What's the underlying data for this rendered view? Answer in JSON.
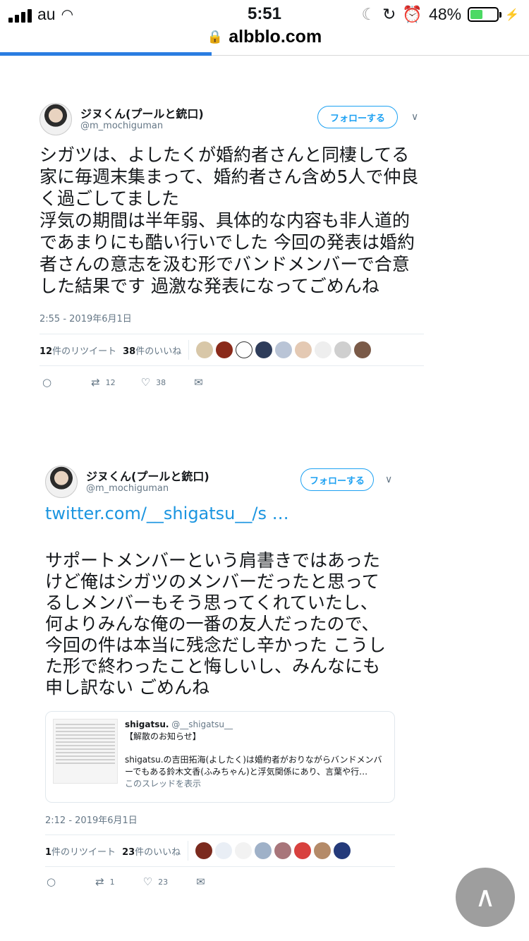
{
  "status": {
    "carrier": "au",
    "time": "5:51",
    "battery": "48%",
    "battery_level": 0.48
  },
  "browser": {
    "url": "albblo.com",
    "load_progress": 0.4
  },
  "tweets": [
    {
      "name": "ジヌくん(プールと銃口)",
      "handle": "@m_mochiguman",
      "follow_label": "フォローする",
      "text": "シガツは、よしたくが婚約者さんと同棲してる家に毎週末集まって、婚約者さん含め5人で仲良く過ごしてました\n浮気の期間は半年弱、具体的な内容も非人道的であまりにも酷い行いでした 今回の発表は婚約者さんの意志を汲む形でバンドメンバーで合意した結果です 過激な発表になってごめんね",
      "timestamp": "2:55 - 2019年6月1日",
      "retweets_num": "12",
      "retweets_suffix": "件のリツイート",
      "likes_num": "38",
      "likes_suffix": "件のいいね",
      "action_retweets": "12",
      "action_likes": "38"
    },
    {
      "name": "ジヌくん(プールと銃口)",
      "handle": "@m_mochiguman",
      "follow_label": "フォローする",
      "link": "twitter.com/__shigatsu__/s …",
      "text": "サポートメンバーという肩書きではあったけど俺はシガツのメンバーだったと思ってるしメンバーもそう思ってくれていたし、何よりみんな俺の一番の友人だったので、今回の件は本当に残念だし辛かった こうした形で終わったこと悔しいし、みんなにも申し訳ない ごめんね",
      "quote": {
        "name": "shigatsu.",
        "handle": "@__shigatsu__",
        "line1": "【解散のお知らせ】",
        "line2": "shigatsu.の吉田拓海(よしたく)は婚約者がおりながらバンドメンバーでもある鈴木文香(ふみちゃん)と浮気関係にあり、言葉や行…",
        "show_thread": "このスレッドを表示"
      },
      "timestamp": "2:12 - 2019年6月1日",
      "retweets_num": "1",
      "retweets_suffix": "件のリツイート",
      "likes_num": "23",
      "likes_suffix": "件のいいね",
      "action_retweets": "1",
      "action_likes": "23"
    }
  ],
  "icons": [
    "lock-icon",
    "reply-icon",
    "retweet-icon",
    "like-icon",
    "message-icon",
    "chevron-down-icon",
    "chevron-up-icon"
  ],
  "colors": {
    "accent": "#1da1f2",
    "link": "#1b95e0",
    "muted": "#657786",
    "battery": "#4cd964"
  }
}
